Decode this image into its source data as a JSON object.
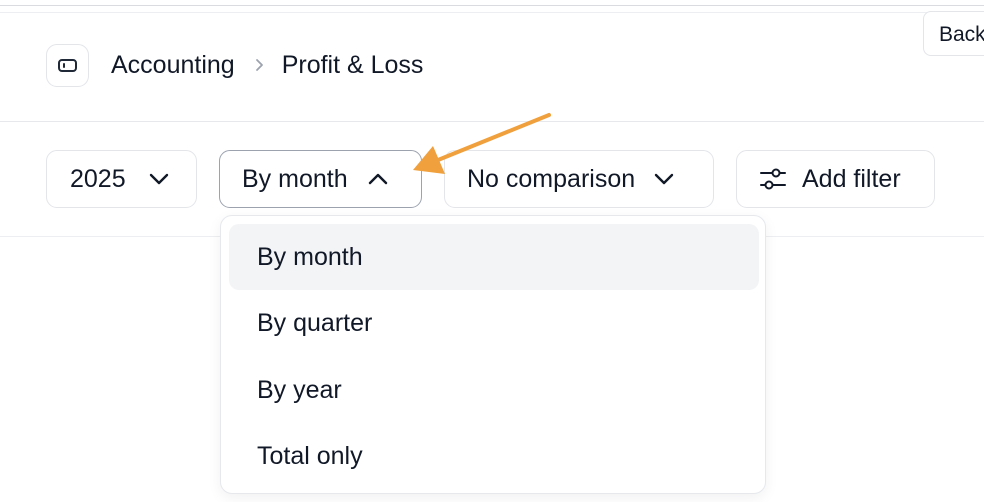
{
  "header": {
    "breadcrumb": {
      "section": "Accounting",
      "page": "Profit & Loss"
    },
    "back_label": "Back"
  },
  "filters": {
    "year": {
      "value": "2025"
    },
    "period": {
      "value": "By month",
      "expanded": true
    },
    "comparison": {
      "value": "No comparison"
    },
    "add_filter_label": "Add filter"
  },
  "period_menu": {
    "options": [
      {
        "label": "By month",
        "selected": true
      },
      {
        "label": "By quarter",
        "selected": false
      },
      {
        "label": "By year",
        "selected": false
      },
      {
        "label": "Total only",
        "selected": false
      }
    ]
  },
  "icons": {
    "sidebar_toggle": "sidebar-toggle-icon",
    "breadcrumb_separator": "chevron-right-icon",
    "collapsed": "chevron-down-icon",
    "expanded": "chevron-up-icon",
    "filter": "sliders-icon"
  },
  "colors": {
    "annotation_arrow": "#f0a03c",
    "selected_row": "#f3f4f6",
    "border": "#e3e5e9",
    "text": "#111827"
  }
}
